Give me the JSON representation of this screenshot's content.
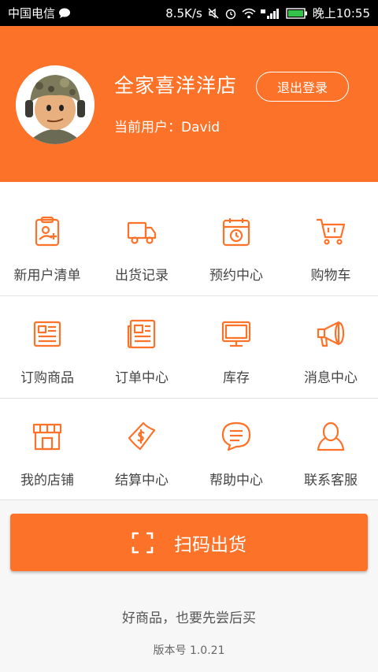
{
  "status_bar": {
    "carrier": "中国电信",
    "speed": "8.5K/s",
    "time": "晚上10:55"
  },
  "header": {
    "store_name": "全家喜洋洋店",
    "current_user": "当前用户：David",
    "logout_label": "退出登录"
  },
  "menu": [
    {
      "label": "新用户清单",
      "icon": "clipboard-user-icon"
    },
    {
      "label": "出货记录",
      "icon": "truck-icon"
    },
    {
      "label": "预约中心",
      "icon": "calendar-clock-icon"
    },
    {
      "label": "购物车",
      "icon": "cart-icon"
    },
    {
      "label": "订购商品",
      "icon": "document-icon"
    },
    {
      "label": "订单中心",
      "icon": "newspaper-icon"
    },
    {
      "label": "库存",
      "icon": "monitor-icon"
    },
    {
      "label": "消息中心",
      "icon": "megaphone-icon"
    },
    {
      "label": "我的店铺",
      "icon": "storefront-icon"
    },
    {
      "label": "结算中心",
      "icon": "money-icon"
    },
    {
      "label": "帮助中心",
      "icon": "chat-bubble-icon"
    },
    {
      "label": "联系客服",
      "icon": "person-icon"
    }
  ],
  "scan_button": {
    "label": "扫码出货",
    "icon": "scan-frame-icon"
  },
  "slogan": "好商品，也要先尝后买",
  "version": "版本号 1.0.21",
  "colors": {
    "accent": "#fd7229",
    "status_bar": "#000000",
    "label_text": "#444444"
  }
}
